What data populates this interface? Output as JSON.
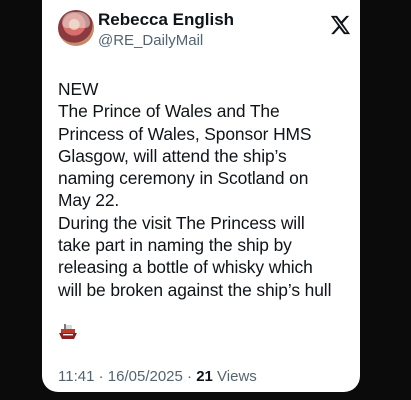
{
  "tweet": {
    "author_name": "Rebecca English",
    "author_handle": "@RE_DailyMail",
    "text": "NEW\nThe Prince of Wales and The\nPrincess of Wales, Sponsor HMS\nGlasgow, will attend the ship’s\nnaming ceremony in Scotland on\nMay 22.\nDuring the visit The Princess will\ntake part in naming the ship by\nreleasing a bottle of whisky which\nwill be broken against the ship’s hull",
    "emoji": "ship-emoji",
    "time": "11:41",
    "separator": " · ",
    "date": "16/05/2025",
    "views_count": "21",
    "views_label": " Views"
  },
  "icons": {
    "platform_logo": "x-logo-icon"
  },
  "colors": {
    "background": "#0b0b0b",
    "card": "#ffffff",
    "text_primary": "#0f1419",
    "text_secondary": "#536471"
  }
}
